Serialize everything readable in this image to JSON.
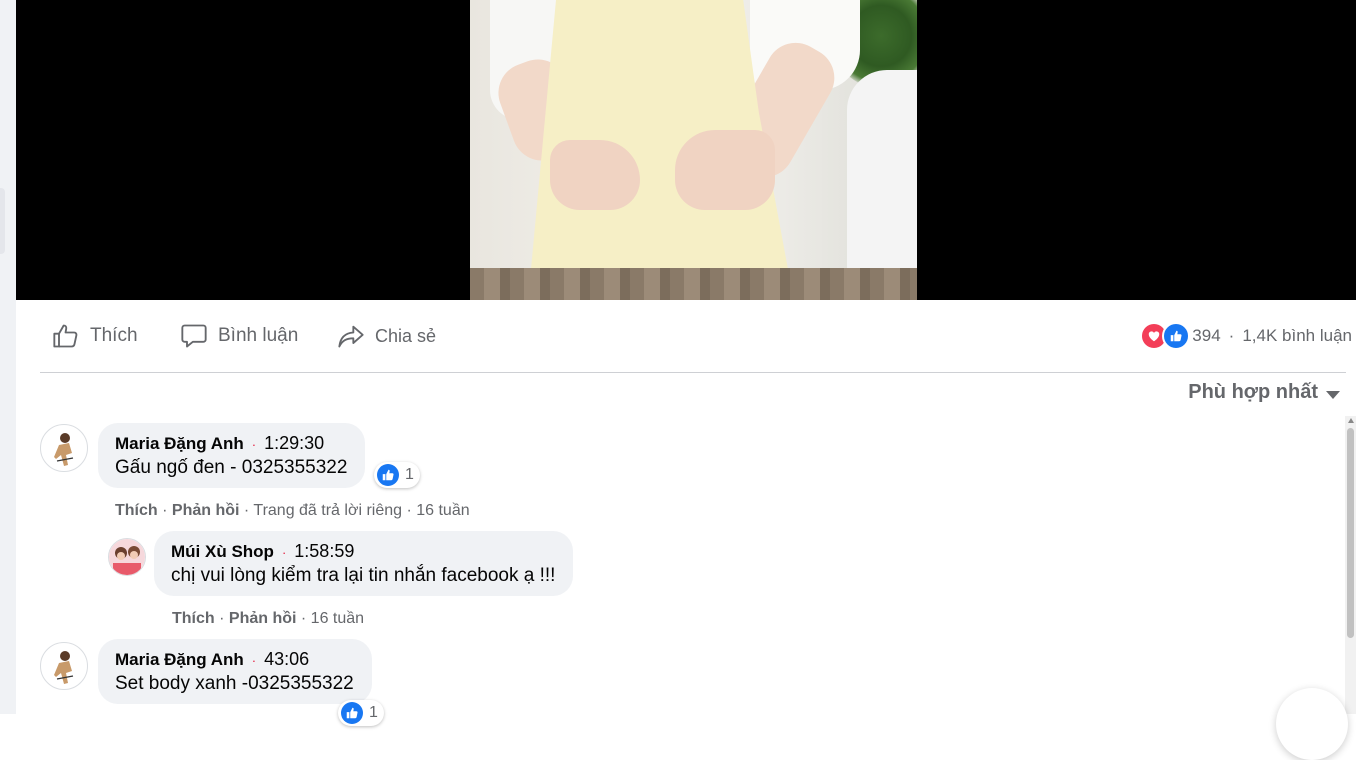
{
  "actions": {
    "like_label": "Thích",
    "comment_label": "Bình luận",
    "share_label": "Chia sẻ"
  },
  "stats": {
    "reaction_count": "394",
    "separator": "·",
    "comments_label": "1,4K bình luận"
  },
  "sort": {
    "label": "Phù hợp nhất"
  },
  "comments": [
    {
      "author": "Maria Đặng Anh",
      "sep": "·",
      "time": "1:29:30",
      "text": "Gấu ngố đen - 0325355322",
      "like_count": "1",
      "like_label": "Thích",
      "reply_label": "Phản hồi",
      "meta_rest": " · Trang đã trả lời riêng · 16 tuần"
    },
    {
      "author": "Múi Xù Shop",
      "sep": "·",
      "time": "1:58:59",
      "text": "chị vui lòng kiểm tra lại tin nhắn facebook ạ !!!",
      "like_label": "Thích",
      "reply_label": "Phản hồi",
      "meta_rest": " · 16 tuần"
    },
    {
      "author": "Maria Đặng Anh",
      "sep": "·",
      "time": "43:06",
      "text": "Set body xanh -0325355322",
      "like_count": "1"
    }
  ],
  "colors": {
    "like_blue": "#1877f2",
    "love_red": "#f33e58",
    "secondary_text": "#65676b",
    "bubble_bg": "#f0f2f5"
  }
}
